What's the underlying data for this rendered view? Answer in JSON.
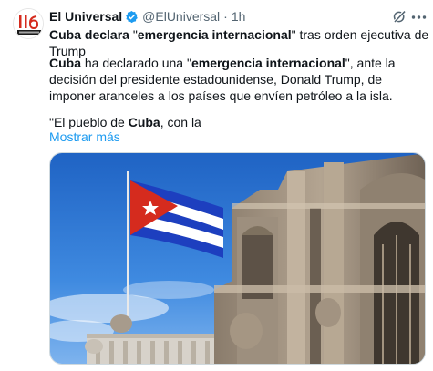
{
  "post": {
    "author_name": "El Universal",
    "handle": "@ElUniversal",
    "separator": "·",
    "time": "1h",
    "avatar_text": "116 EL UNIVERSAL",
    "headline": {
      "bold1": "Cuba declara",
      "plain1": " \"",
      "bold2": "emergencia internacional",
      "plain2": "\" tras orden ejecutiva de Trump"
    },
    "body": {
      "bold1": "Cuba",
      "plain1": " ha declarado una \"",
      "bold2": "emergencia internacional",
      "plain2": "\", ante la decisión del presidente estadounidense, Donald Trump, de imponer aranceles a los países que envíen petróleo a la isla."
    },
    "quote": {
      "plain1": "\"El pueblo de ",
      "bold1": "Cuba",
      "plain2": ", con la"
    },
    "show_more": "Mostrar más"
  },
  "icons": {
    "verified": "verified-badge-icon",
    "grok": "grok-icon",
    "more": "more-options-icon"
  },
  "colors": {
    "link": "#1d9bf0",
    "verified": "#1d9bf0",
    "secondary_text": "#536471",
    "flag_red": "#d52b1e",
    "flag_blue": "#1d3fbf"
  }
}
